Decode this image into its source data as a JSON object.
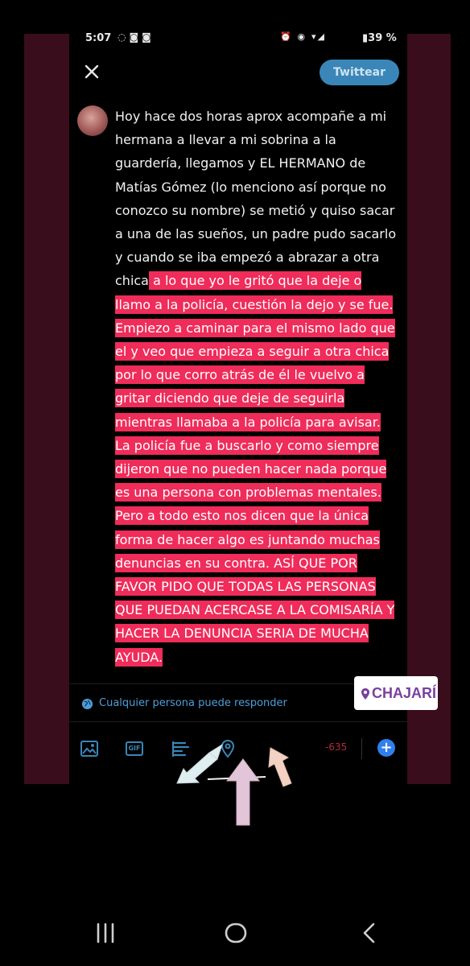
{
  "status_bar": {
    "time": "5:07",
    "left_icons": [
      "whatsapp-icon",
      "instagram-icon",
      "instagram-icon"
    ],
    "right_icons": [
      "alarm-icon",
      "eye-icon",
      "wifi-icon",
      "signal-icon"
    ],
    "battery": "39 %"
  },
  "compose": {
    "twittear_label": "Twittear",
    "text_plain": "Hoy hace dos horas aprox acompañe a mi hermana a llevar a mi sobrina a la guardería, llegamos y EL HERMANO de Matías Gómez (lo menciono así porque no conozco su nombre) se metió y quiso sacar a una de las sueños, un padre pudo sacarlo y cuando se iba empezó a abrazar a otra chica",
    "text_highlighted": " a lo que yo le gritó que la deje o llamo a la policía, cuestión la dejo y se fue. Empiezo a caminar para el mismo lado que el y veo que empieza a seguir a otra chica por lo que corro atrás de él le vuelvo a gritar diciendo que deje de seguirla mientras llamaba a la policía para avisar. La policía fue a buscarlo y como siempre dijeron que no pueden hacer nada porque es una persona con problemas mentales. Pero a todo esto nos dicen que la única forma de hacer algo es juntando muchas denuncias en su contra. ASÍ QUE POR FAVOR PIDO QUE TODAS LAS PERSONAS QUE PUEDAN ACERCASE A LA COMISARÍA Y HACER LA DENUNCIA SERIA DE MUCHA AYUDA.",
    "highlight_color": "#ef2c5a",
    "reply_setting": "Cualquier persona puede responder"
  },
  "sticker": {
    "location": "CHAJARÍ"
  },
  "toolbar": {
    "gif_label": "GIF",
    "char_count": "-635",
    "add_label": "+"
  },
  "colors": {
    "accent": "#3a86b8",
    "side_panel": "#3a0d1c"
  }
}
